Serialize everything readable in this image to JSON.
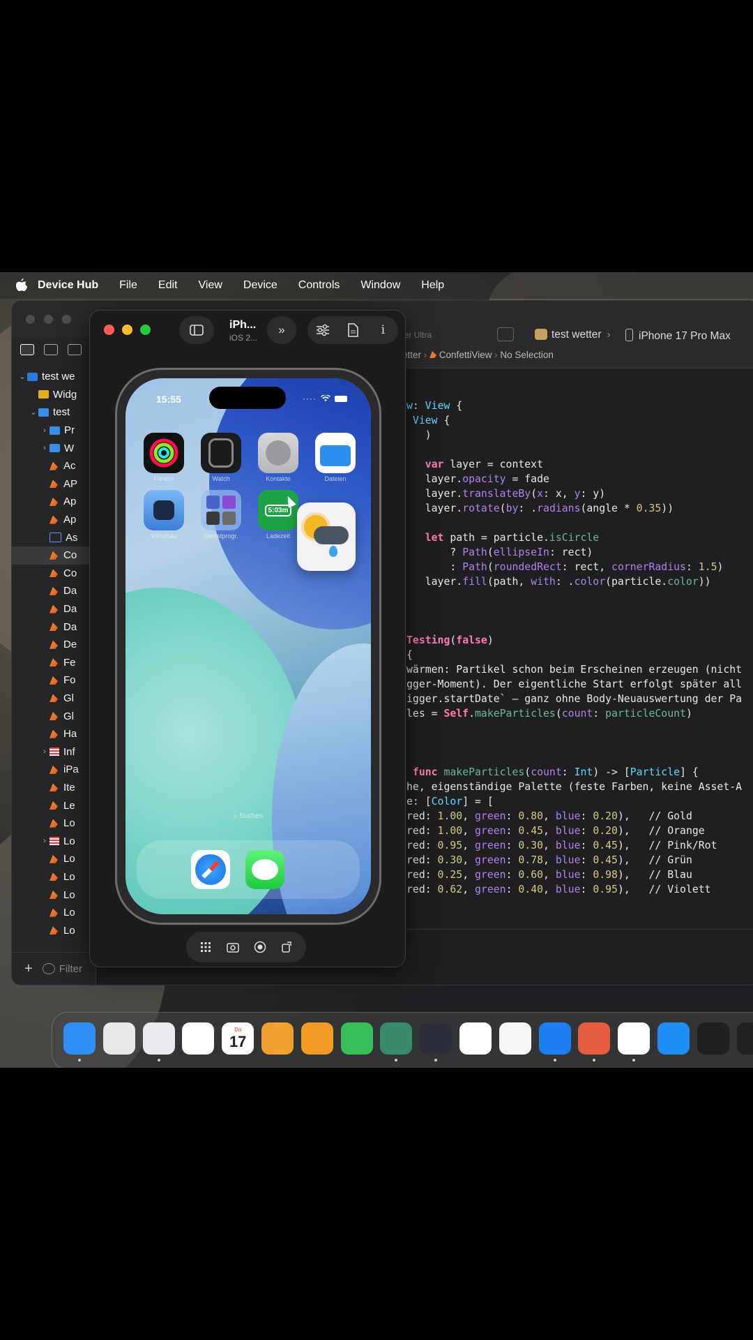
{
  "menubar": {
    "app_name": "Device Hub",
    "items": [
      "File",
      "Edit",
      "View",
      "Device",
      "Controls",
      "Window",
      "Help"
    ]
  },
  "xcode": {
    "subtitle_partial": "tter Ultra",
    "scheme": "test wetter",
    "destination": "iPhone 17 Pro Max",
    "breadcrumb": [
      "etter",
      "ConfettiView",
      "No Selection"
    ],
    "navigator": {
      "rows": [
        {
          "label": "test we",
          "kind": "project",
          "indent": 0,
          "chevron": "⌄"
        },
        {
          "label": "Widg",
          "kind": "widget",
          "indent": 1,
          "chevron": ""
        },
        {
          "label": "test",
          "kind": "folder",
          "indent": 1,
          "chevron": "⌄"
        },
        {
          "label": "Pr",
          "kind": "folder",
          "indent": 2,
          "chevron": "›"
        },
        {
          "label": "W",
          "kind": "folder",
          "indent": 2,
          "chevron": "›"
        },
        {
          "label": "Ac",
          "kind": "swift",
          "indent": 2,
          "chevron": ""
        },
        {
          "label": "AP",
          "kind": "swift",
          "indent": 2,
          "chevron": ""
        },
        {
          "label": "Ap",
          "kind": "swift",
          "indent": 2,
          "chevron": ""
        },
        {
          "label": "Ap",
          "kind": "swift",
          "indent": 2,
          "chevron": ""
        },
        {
          "label": "As",
          "kind": "assets",
          "indent": 2,
          "chevron": ""
        },
        {
          "label": "Co",
          "kind": "swift",
          "indent": 2,
          "chevron": "",
          "selected": true
        },
        {
          "label": "Co",
          "kind": "swift",
          "indent": 2,
          "chevron": ""
        },
        {
          "label": "Da",
          "kind": "swift",
          "indent": 2,
          "chevron": ""
        },
        {
          "label": "Da",
          "kind": "swift",
          "indent": 2,
          "chevron": ""
        },
        {
          "label": "Da",
          "kind": "swift",
          "indent": 2,
          "chevron": ""
        },
        {
          "label": "De",
          "kind": "swift",
          "indent": 2,
          "chevron": ""
        },
        {
          "label": "Fe",
          "kind": "swift",
          "indent": 2,
          "chevron": ""
        },
        {
          "label": "Fo",
          "kind": "swift",
          "indent": 2,
          "chevron": ""
        },
        {
          "label": "Gl",
          "kind": "swift",
          "indent": 2,
          "chevron": ""
        },
        {
          "label": "Gl",
          "kind": "swift",
          "indent": 2,
          "chevron": ""
        },
        {
          "label": "Ha",
          "kind": "swift",
          "indent": 2,
          "chevron": ""
        },
        {
          "label": "Inf",
          "kind": "strings",
          "indent": 2,
          "chevron": "›"
        },
        {
          "label": "iPa",
          "kind": "swift",
          "indent": 2,
          "chevron": ""
        },
        {
          "label": "Ite",
          "kind": "swift",
          "indent": 2,
          "chevron": ""
        },
        {
          "label": "Le",
          "kind": "swift",
          "indent": 2,
          "chevron": ""
        },
        {
          "label": "Lo",
          "kind": "swift",
          "indent": 2,
          "chevron": ""
        },
        {
          "label": "Lo",
          "kind": "strings",
          "indent": 2,
          "chevron": "›"
        },
        {
          "label": "Lo",
          "kind": "swift",
          "indent": 2,
          "chevron": ""
        },
        {
          "label": "Lo",
          "kind": "swift",
          "indent": 2,
          "chevron": ""
        },
        {
          "label": "Lo",
          "kind": "swift",
          "indent": 2,
          "chevron": ""
        },
        {
          "label": "Lo",
          "kind": "swift",
          "indent": 2,
          "chevron": ""
        },
        {
          "label": "Lo",
          "kind": "swift",
          "indent": 2,
          "chevron": ""
        }
      ],
      "filter_placeholder": "Filter"
    },
    "code_lines": [
      [
        [
          "t",
          "w"
        ],
        [
          "",
          ": "
        ],
        [
          "t",
          "View"
        ],
        [
          "",
          " {"
        ]
      ],
      [
        [
          "",
          ""
        ],
        [
          "t",
          " View"
        ],
        [
          "",
          " {"
        ]
      ],
      [
        [
          "",
          "   )"
        ]
      ],
      [
        [
          "",
          ""
        ]
      ],
      [
        [
          "k",
          "   var"
        ],
        [
          "",
          " layer = context"
        ]
      ],
      [
        [
          "",
          "   layer."
        ],
        [
          "m",
          "opacity"
        ],
        [
          "",
          " = fade"
        ]
      ],
      [
        [
          "",
          "   layer."
        ],
        [
          "m",
          "translateBy"
        ],
        [
          "",
          "("
        ],
        [
          "m",
          "x"
        ],
        [
          "",
          ": x, "
        ],
        [
          "m",
          "y"
        ],
        [
          "",
          ": y)"
        ]
      ],
      [
        [
          "",
          "   layer."
        ],
        [
          "m",
          "rotate"
        ],
        [
          "",
          "("
        ],
        [
          "m",
          "by"
        ],
        [
          "",
          ": ."
        ],
        [
          "m",
          "radians"
        ],
        [
          "",
          "(angle * "
        ],
        [
          "n",
          "0.35"
        ],
        [
          "",
          "))"
        ]
      ],
      [
        [
          "",
          ""
        ]
      ],
      [
        [
          "k",
          "   let"
        ],
        [
          "",
          " path = particle."
        ],
        [
          "f",
          "isCircle"
        ]
      ],
      [
        [
          "",
          "       ? "
        ],
        [
          "m",
          "Path"
        ],
        [
          "",
          "("
        ],
        [
          "m",
          "ellipseIn"
        ],
        [
          "",
          ": rect)"
        ]
      ],
      [
        [
          "",
          "       : "
        ],
        [
          "m",
          "Path"
        ],
        [
          "",
          "("
        ],
        [
          "m",
          "roundedRect"
        ],
        [
          "",
          ": rect, "
        ],
        [
          "m",
          "cornerRadius"
        ],
        [
          "",
          ": "
        ],
        [
          "n",
          "1.5"
        ],
        [
          "",
          ")"
        ]
      ],
      [
        [
          "",
          "   layer."
        ],
        [
          "m",
          "fill"
        ],
        [
          "",
          "(path, "
        ],
        [
          "m",
          "with"
        ],
        [
          "",
          ": ."
        ],
        [
          "m",
          "color"
        ],
        [
          "",
          "(particle."
        ],
        [
          "f",
          "color"
        ],
        [
          "",
          "))"
        ]
      ],
      [
        [
          "",
          ""
        ]
      ],
      [
        [
          "",
          ""
        ]
      ],
      [
        [
          "",
          ""
        ]
      ],
      [
        [
          "k",
          "Testing"
        ],
        [
          "",
          "("
        ],
        [
          "k",
          "false"
        ],
        [
          "",
          ")"
        ]
      ],
      [
        [
          "",
          "{"
        ]
      ],
      [
        [
          "",
          "wärmen: Partikel schon beim Erscheinen erzeugen (nicht"
        ]
      ],
      [
        [
          "",
          "gger-Moment). Der eigentliche Start erfolgt später all"
        ]
      ],
      [
        [
          "",
          "igger.startDate` — ganz ohne Body-Neuauswertung der Pa"
        ]
      ],
      [
        [
          "",
          "les = "
        ],
        [
          "k",
          "Self"
        ],
        [
          "",
          "."
        ],
        [
          "f",
          "makeParticles"
        ],
        [
          "",
          "("
        ],
        [
          "m",
          "count"
        ],
        [
          "",
          ": "
        ],
        [
          "f",
          "particleCount"
        ],
        [
          "",
          ")"
        ]
      ],
      [
        [
          "",
          ""
        ]
      ],
      [
        [
          "",
          ""
        ]
      ],
      [
        [
          "",
          ""
        ]
      ],
      [
        [
          "k",
          " func"
        ],
        [
          "",
          " "
        ],
        [
          "f",
          "makeParticles"
        ],
        [
          "",
          "("
        ],
        [
          "m",
          "count"
        ],
        [
          "",
          ": "
        ],
        [
          "t",
          "Int"
        ],
        [
          "",
          ") -> ["
        ],
        [
          "t",
          "Particle"
        ],
        [
          "",
          "] {"
        ]
      ],
      [
        [
          "",
          "he, eigenständige Palette (feste Farben, keine Asset-A"
        ]
      ],
      [
        [
          "",
          "e: ["
        ],
        [
          "t",
          "Color"
        ],
        [
          "",
          "] = ["
        ]
      ],
      [
        [
          "",
          "red: "
        ],
        [
          "n",
          "1.00"
        ],
        [
          "",
          ", "
        ],
        [
          "m",
          "green"
        ],
        [
          "",
          ": "
        ],
        [
          "n",
          "0.80"
        ],
        [
          "",
          ", "
        ],
        [
          "m",
          "blue"
        ],
        [
          "",
          ": "
        ],
        [
          "n",
          "0.20"
        ],
        [
          "",
          "),   // Gold"
        ]
      ],
      [
        [
          "",
          "red: "
        ],
        [
          "n",
          "1.00"
        ],
        [
          "",
          ", "
        ],
        [
          "m",
          "green"
        ],
        [
          "",
          ": "
        ],
        [
          "n",
          "0.45"
        ],
        [
          "",
          ", "
        ],
        [
          "m",
          "blue"
        ],
        [
          "",
          ": "
        ],
        [
          "n",
          "0.20"
        ],
        [
          "",
          "),   // Orange"
        ]
      ],
      [
        [
          "",
          "red: "
        ],
        [
          "n",
          "0.95"
        ],
        [
          "",
          ", "
        ],
        [
          "m",
          "green"
        ],
        [
          "",
          ": "
        ],
        [
          "n",
          "0.30"
        ],
        [
          "",
          ", "
        ],
        [
          "m",
          "blue"
        ],
        [
          "",
          ": "
        ],
        [
          "n",
          "0.45"
        ],
        [
          "",
          "),   // Pink/Rot"
        ]
      ],
      [
        [
          "",
          "red: "
        ],
        [
          "n",
          "0.30"
        ],
        [
          "",
          ", "
        ],
        [
          "m",
          "green"
        ],
        [
          "",
          ": "
        ],
        [
          "n",
          "0.78"
        ],
        [
          "",
          ", "
        ],
        [
          "m",
          "blue"
        ],
        [
          "",
          ": "
        ],
        [
          "n",
          "0.45"
        ],
        [
          "",
          "),   // Grün"
        ]
      ],
      [
        [
          "",
          "red: "
        ],
        [
          "n",
          "0.25"
        ],
        [
          "",
          ", "
        ],
        [
          "m",
          "green"
        ],
        [
          "",
          ": "
        ],
        [
          "n",
          "0.60"
        ],
        [
          "",
          ", "
        ],
        [
          "m",
          "blue"
        ],
        [
          "",
          ": "
        ],
        [
          "n",
          "0.98"
        ],
        [
          "",
          "),   // Blau"
        ]
      ],
      [
        [
          "",
          "red: "
        ],
        [
          "n",
          "0.62"
        ],
        [
          "",
          ", "
        ],
        [
          "m",
          "green"
        ],
        [
          "",
          ": "
        ],
        [
          "n",
          "0.40"
        ],
        [
          "",
          ", "
        ],
        [
          "m",
          "blue"
        ],
        [
          "",
          ": "
        ],
        [
          "n",
          "0.95"
        ],
        [
          "",
          "),   // Violett"
        ]
      ]
    ]
  },
  "simulator": {
    "title": "iPh...",
    "subtitle": "iOS 2...",
    "phone": {
      "time": "15:55",
      "apps": [
        {
          "name": "Fitness",
          "color": "#111"
        },
        {
          "name": "Watch",
          "color": "#1c1c1e"
        },
        {
          "name": "Kontakte",
          "color": "#c9c9cc"
        },
        {
          "name": "Dateien",
          "color": "#2e8ef0"
        },
        {
          "name": "Vorschau",
          "color": "#5aa7f2"
        },
        {
          "name": "Dienstprogr.",
          "color": "#6ea7ea"
        },
        {
          "name": "Ladezeit",
          "color": "#1fa347"
        }
      ],
      "ladezeit_value": "5:03m",
      "search_label": "Suchen",
      "dock_apps": [
        "Safari",
        "Nachrichten"
      ]
    }
  },
  "macdock": {
    "apps": [
      {
        "name": "finder-icon",
        "color": "#2f8ef4"
      },
      {
        "name": "launchpad-icon",
        "color": "#e8e8ea"
      },
      {
        "name": "safari-icon",
        "color": "#eaeaee"
      },
      {
        "name": "photos-icon",
        "color": "#ffffff"
      },
      {
        "name": "calendar-icon",
        "color": "#ffffff",
        "text": "17",
        "subtext": "Do"
      },
      {
        "name": "findmy-icon",
        "color": "#f0a030"
      },
      {
        "name": "pages-icon",
        "color": "#f29b27"
      },
      {
        "name": "numbers-icon",
        "color": "#38c058"
      },
      {
        "name": "instruments-icon",
        "color": "#3a8a6a"
      },
      {
        "name": "voice-memos-icon",
        "color": "#2b2d3a"
      },
      {
        "name": "xmind-icon",
        "color": "#ffffff"
      },
      {
        "name": "testflight-icon",
        "color": "#f6f6f8"
      },
      {
        "name": "xcode-icon",
        "color": "#1d7ff0"
      },
      {
        "name": "claude-icon",
        "color": "#e85d3d"
      },
      {
        "name": "chatgpt-icon",
        "color": "#ffffff"
      },
      {
        "name": "appstore-icon",
        "color": "#1c8ef4"
      },
      {
        "name": "finalcut-icon",
        "color": "#202020"
      },
      {
        "name": "spark-icon",
        "color": "#222"
      }
    ]
  }
}
